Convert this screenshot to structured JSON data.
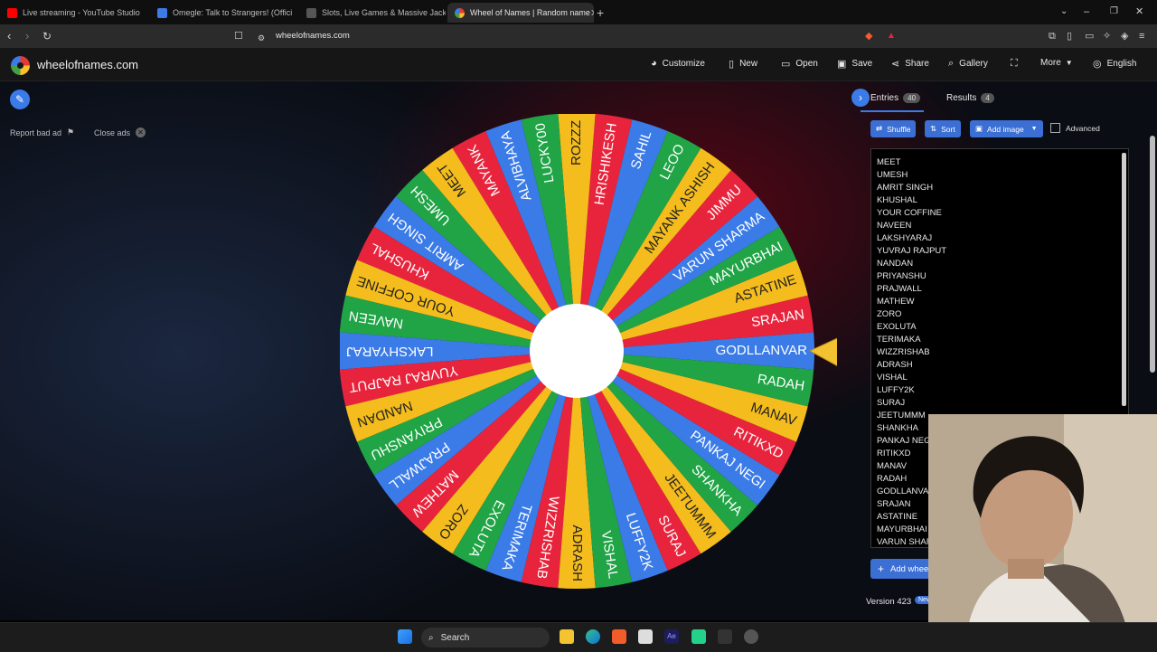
{
  "browser": {
    "tabs": [
      {
        "title": "Live streaming - YouTube Studio",
        "color": "#ff0000",
        "active": false
      },
      {
        "title": "Omegle: Talk to Strangers! (Offici",
        "color": "#3b7be8",
        "active": false
      },
      {
        "title": "Slots, Live Games & Massive Jackpot",
        "color": "#444444",
        "active": false
      },
      {
        "title": "Wheel of Names | Random name",
        "color": "#43a047",
        "active": true
      }
    ],
    "url": "wheelofnames.com"
  },
  "site": {
    "name": "wheelofnames.com",
    "nav": {
      "customize": "Customize",
      "new": "New",
      "open": "Open",
      "save": "Save",
      "share": "Share",
      "gallery": "Gallery",
      "more": "More",
      "language": "English"
    }
  },
  "ads": {
    "report": "Report bad ad",
    "close": "Close ads"
  },
  "wheel": {
    "colors": [
      "#3b7be8",
      "#e8243c",
      "#f4bc1c",
      "#20a446"
    ],
    "slices": [
      "GODLLANVAR",
      "SRAJAN",
      "ASTATINE",
      "MAYURBHAI",
      "VARUN SHARMA",
      "JIMMU",
      "MAYANK ASHISH",
      "LEOO",
      "SAHIL",
      "HRISHIKESH",
      "ROZZZ",
      "LUCKY00",
      "ALVIBHAYA",
      "MAYANK",
      "MEET",
      "UMESH",
      "AMRIT SINGH",
      "KHUSHAL",
      "YOUR COFFINE",
      "NAVEEN",
      "LAKSHYARAJ",
      "YUVRAJ RAJPUT",
      "NANDAN",
      "PRIYANSHU",
      "PRAJWALL",
      "MATHEW",
      "ZORO",
      "EXOLUTA",
      "TERIMAKA",
      "WIZZRISHAB",
      "ADRASH",
      "VISHAL",
      "LUFFY2K",
      "SURAJ",
      "JEETUMMM",
      "SHANKHA",
      "PANKAJ NEGI",
      "RITIKXD",
      "MANAV",
      "RADAH"
    ]
  },
  "panel": {
    "entries_tab": "Entries",
    "entries_count": "40",
    "results_tab": "Results",
    "results_count": "4",
    "shuffle": "Shuffle",
    "sort": "Sort",
    "add_image": "Add image",
    "advanced": "Advanced",
    "add_wheel": "Add whee",
    "version": "Version 423",
    "new_badge": "New"
  },
  "entries": [
    "MEET",
    "UMESH",
    "AMRIT SINGH",
    "KHUSHAL",
    "YOUR COFFINE",
    "NAVEEN",
    "LAKSHYARAJ",
    "YUVRAJ RAJPUT",
    "NANDAN",
    "PRIYANSHU",
    "PRAJWALL",
    "MATHEW",
    "ZORO",
    "EXOLUTA",
    "TERIMAKA",
    "WIZZRISHAB",
    "ADRASH",
    "VISHAL",
    "LUFFY2K",
    "SURAJ",
    "JEETUMMM",
    "SHANKHA",
    "PANKAJ NEGI",
    "RITIKXD",
    "MANAV",
    "RADAH",
    "GODLLANVAR",
    "SRAJAN",
    "ASTATINE",
    "MAYURBHAI",
    "VARUN SHAR"
  ],
  "taskbar": {
    "search": "Search"
  }
}
